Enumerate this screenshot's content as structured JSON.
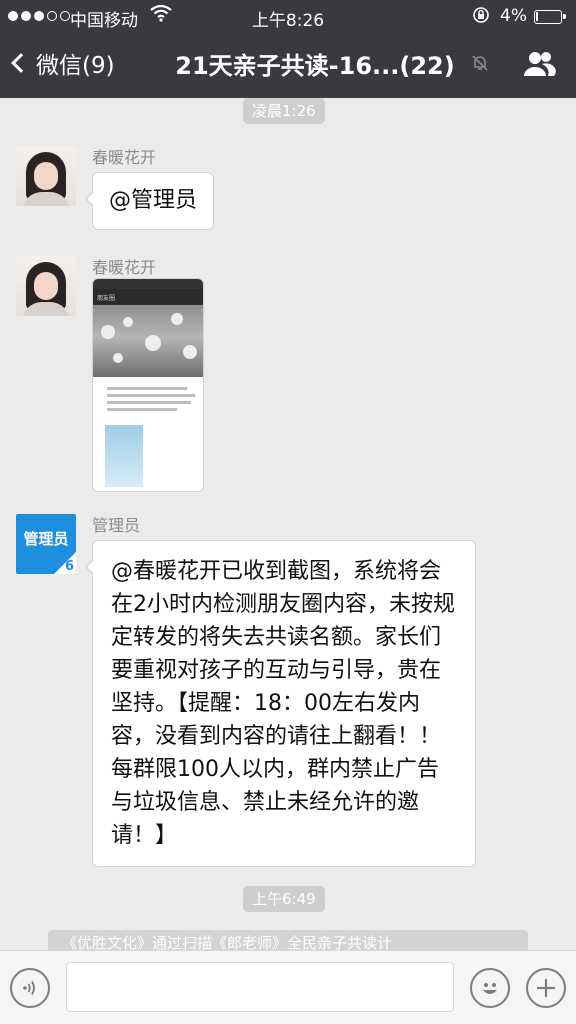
{
  "status_bar": {
    "carrier": "中国移动",
    "time": "上午8:26",
    "battery": "4%"
  },
  "nav": {
    "back_label": "微信(9)",
    "title": "21天亲子共读-16...(22)"
  },
  "chat": {
    "timestamp_1": "凌晨1:26",
    "msg1": {
      "sender": "春暖花开",
      "text": "@管理员"
    },
    "msg2": {
      "sender": "春暖花开",
      "image_caption": "朋友圈"
    },
    "msg3": {
      "sender": "管理员",
      "avatar_label": "管理员",
      "avatar_badge": "6",
      "text": "@春暖花开已收到截图，系统将会在2小时内检测朋友圈内容，未按规定转发的将失去共读名额。家长们要重视对孩子的互动与引导，贵在坚持。【提醒：18：00左右发内容，没看到内容的请往上翻看！！每群限100人以内，群内禁止广告与垃圾信息、禁止未经允许的邀请！】"
    },
    "timestamp_2": "上午6:49",
    "peek_text": "《优胜文化》通过扫描《郎老师》全民亲子共读计"
  },
  "colors": {
    "nav_bg": "#393a3f",
    "chat_bg": "#ebebeb",
    "admin_avatar": "#1e8fde"
  }
}
